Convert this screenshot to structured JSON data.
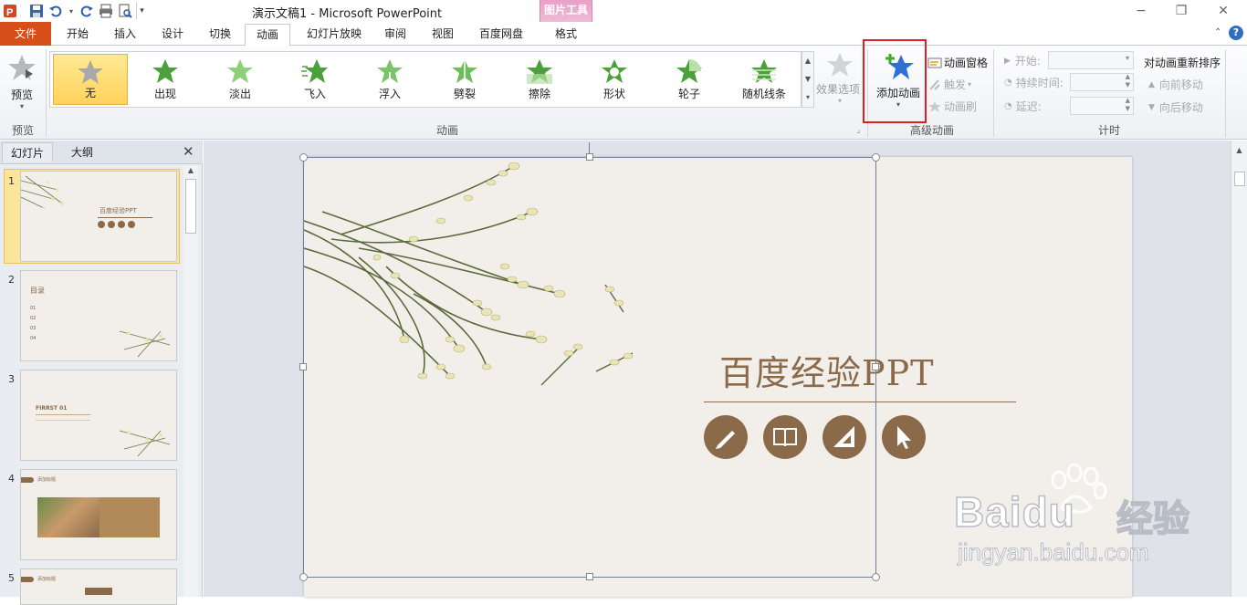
{
  "window": {
    "title": "演示文稿1 - Microsoft PowerPoint",
    "context_tab_group": "图片工具"
  },
  "tabs": [
    "文件",
    "开始",
    "插入",
    "设计",
    "切换",
    "动画",
    "幻灯片放映",
    "审阅",
    "视图",
    "百度网盘",
    "格式"
  ],
  "active_tab": "动画",
  "ribbon": {
    "preview": {
      "label": "预览",
      "group": "预览"
    },
    "animation_gallery": {
      "group": "动画",
      "items": [
        "无",
        "出现",
        "淡出",
        "飞入",
        "浮入",
        "劈裂",
        "擦除",
        "形状",
        "轮子",
        "随机线条"
      ],
      "selected": "无"
    },
    "effect_options": "效果选项",
    "advanced": {
      "group": "高级动画",
      "add_animation": "添加动画",
      "animation_pane": "动画窗格",
      "trigger": "触发",
      "animation_painter": "动画刷"
    },
    "timing": {
      "group": "计时",
      "start": "开始:",
      "duration": "持续时间:",
      "delay": "延迟:",
      "reorder": "对动画重新排序",
      "move_earlier": "向前移动",
      "move_later": "向后移动"
    }
  },
  "panel": {
    "tabs": [
      "幻灯片",
      "大纲"
    ],
    "slides": [
      "1",
      "2",
      "3",
      "4",
      "5"
    ],
    "thumb_texts": {
      "s1_title": "百度经验PPT",
      "s2_title": "目录",
      "s2_items": [
        "01",
        "02",
        "03",
        "04"
      ],
      "s3_title": "FIRRST 01",
      "s4_title": "添加标题",
      "s5_title": "添加标题"
    }
  },
  "slide": {
    "title": "百度经验PPT",
    "icons": [
      "pen-icon",
      "book-icon",
      "ruler-icon",
      "cursor-icon"
    ]
  },
  "watermark": {
    "brand": "Baidu",
    "suffix": "经验",
    "url": "jingyan.baidu.com"
  },
  "colors": {
    "file_tab": "#d64f1b",
    "accent_brown": "#8b6a4a",
    "highlight_box": "#e02020",
    "gallery_selected": "#ffd35a"
  }
}
